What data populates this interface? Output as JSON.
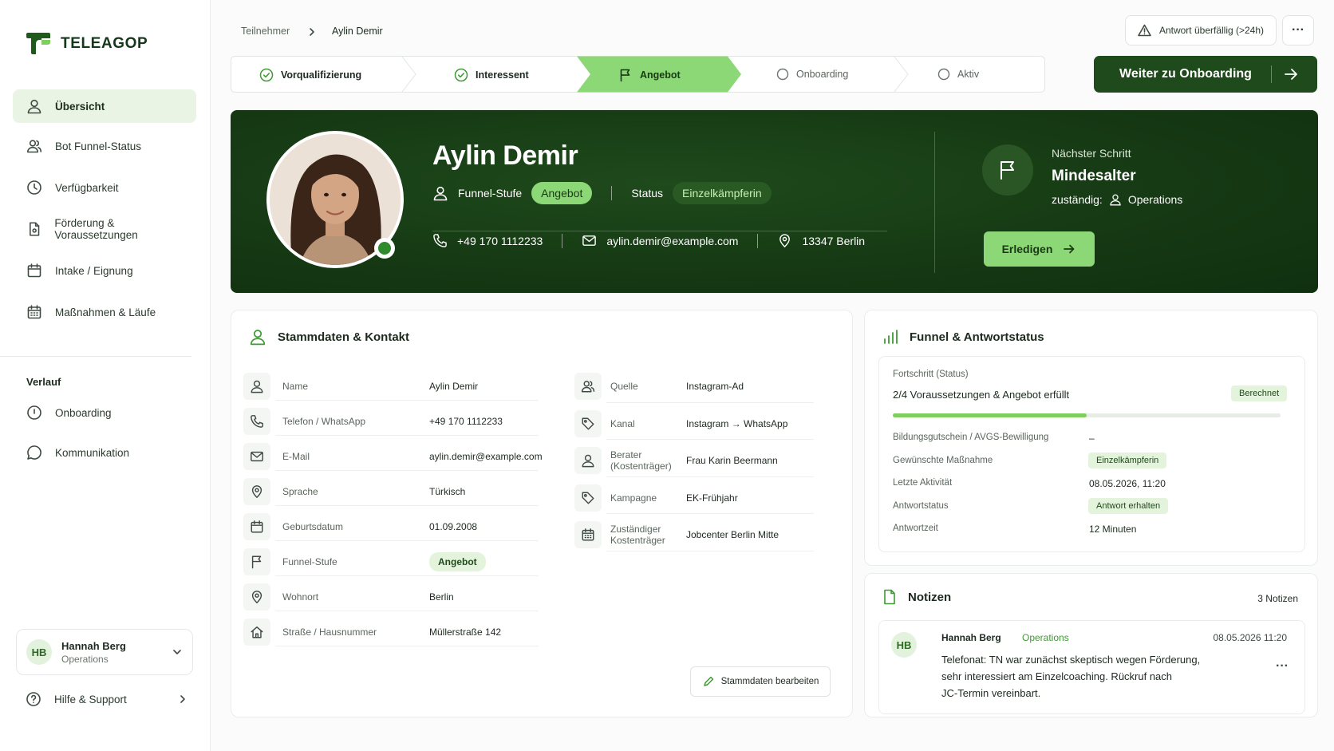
{
  "sidebar": {
    "brand": "TELEAGOP",
    "nav": [
      {
        "label": "Übersicht",
        "icon": "user-icon"
      },
      {
        "label": "Bot Funnel-Status",
        "icon": "users-icon"
      },
      {
        "label": "Verfügbarkeit",
        "icon": "clock-icon"
      },
      {
        "label": "Förderung & Voraussetzungen",
        "icon": "document-icon"
      },
      {
        "label": "Intake / Eignung",
        "icon": "calendar-icon"
      },
      {
        "label": "Maßnahmen & Läufe",
        "icon": "calendar-grid-icon"
      }
    ],
    "history_heading": "Verlauf",
    "history": [
      {
        "label": "Onboarding",
        "icon": "info-icon"
      },
      {
        "label": "Kommunikation",
        "icon": "chat-icon"
      }
    ],
    "user": {
      "initials": "HB",
      "name": "Hannah Berg",
      "role": "Operations"
    },
    "help": "Hilfe & Support"
  },
  "topbar": {
    "breadcrumb": [
      "Teilnehmer",
      "Aylin Demir"
    ],
    "warning": "Antwort überfällig (>24h)",
    "more": "···"
  },
  "stepper": {
    "steps": [
      {
        "label": "Vorqualifizierung",
        "state": "done"
      },
      {
        "label": "Interessent",
        "state": "done"
      },
      {
        "label": "Angebot",
        "state": "active"
      },
      {
        "label": "Onboarding",
        "state": "todo"
      },
      {
        "label": "Aktiv",
        "state": "todo"
      }
    ],
    "next_button": "Weiter zu Onboarding"
  },
  "hero": {
    "name": "Aylin Demir",
    "funnel_label": "Funnel-Stufe",
    "funnel_value": "Angebot",
    "status_label": "Status",
    "status_value": "Einzelkämpferin",
    "phone": "+49 170 1112233",
    "email": "aylin.demir@example.com",
    "location": "13347 Berlin",
    "next_step_label": "Nächster Schritt",
    "next_step_title": "Mindesalter",
    "responsible_label": "zuständig:",
    "responsible_value": "Operations",
    "done_button": "Erledigen"
  },
  "master": {
    "title": "Stammdaten & Kontakt",
    "left": [
      {
        "label": "Name",
        "value": "Aylin Demir",
        "icon": "user-icon"
      },
      {
        "label": "Telefon / WhatsApp",
        "value": "+49 170 1112233",
        "icon": "phone-icon"
      },
      {
        "label": "E-Mail",
        "value": "aylin.demir@example.com",
        "icon": "mail-icon"
      },
      {
        "label": "Sprache",
        "value": "Türkisch",
        "icon": "pin-icon"
      },
      {
        "label": "Geburtsdatum",
        "value": "01.09.2008",
        "icon": "calendar-icon"
      },
      {
        "label": "Funnel-Stufe",
        "value": "Angebot",
        "icon": "flag-icon"
      },
      {
        "label": "Wohnort",
        "value": "Berlin",
        "icon": "pin-icon"
      },
      {
        "label": "Straße / Hausnummer",
        "value": "Müllerstraße 142",
        "icon": "home-icon"
      }
    ],
    "right": [
      {
        "label": "Quelle",
        "value": "Instagram-Ad",
        "icon": "users-icon"
      },
      {
        "label": "Kanal",
        "value": "Instagram → WhatsApp",
        "icon": "tag-icon"
      },
      {
        "label": "Berater (Kostenträger)",
        "value": "Frau Karin Beermann",
        "icon": "user-icon"
      },
      {
        "label": "Kampagne",
        "value": "EK-Frühjahr",
        "icon": "tag-icon"
      },
      {
        "label": "Zuständiger Kostenträger",
        "value": "Jobcenter Berlin Mitte",
        "icon": "calendar-grid-icon"
      }
    ],
    "edit_button": "Stammdaten bearbeiten"
  },
  "funnel": {
    "title": "Funnel & Antwortstatus",
    "progress_label": "Fortschritt (Status)",
    "progress_text": "2/4 Voraussetzungen & Angebot erfüllt",
    "progress_badge": "Berechnet",
    "progress_fraction": 0.5,
    "rows": [
      {
        "label": "Bildungsgutschein / AVGS-Bewilligung",
        "value": "–",
        "tag": false
      },
      {
        "label": "Gewünschte Maßnahme",
        "value": "Einzelkämpferin",
        "tag": true
      },
      {
        "label": "Letzte Aktivität",
        "value": "08.05.2026, 11:20",
        "tag": false
      },
      {
        "label": "Antwortstatus",
        "value": "Antwort erhalten",
        "tag": true
      },
      {
        "label": "Antwortzeit",
        "value": "12 Minuten",
        "tag": false
      }
    ]
  },
  "notes": {
    "title": "Notizen",
    "count": "3 Notizen",
    "items": [
      {
        "initials": "HB",
        "author": "Hannah Berg",
        "team": "Operations",
        "time": "08.05.2026 11:20",
        "lines": [
          "Telefonat: TN war zunächst skeptisch wegen Förderung,",
          "sehr interessiert am Einzelcoaching. Rückruf nach",
          "JC-Termin vereinbart."
        ],
        "more": "···"
      }
    ]
  },
  "colors": {
    "brand_dark": "#1f4a1b",
    "accent_light": "#8dd876",
    "tag_bg": "#e4f4dc"
  }
}
